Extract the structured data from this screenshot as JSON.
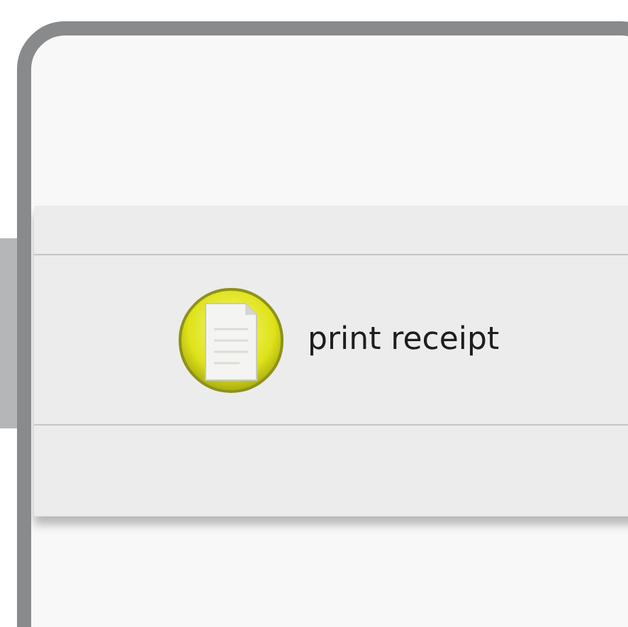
{
  "button": {
    "label": "print receipt"
  }
}
